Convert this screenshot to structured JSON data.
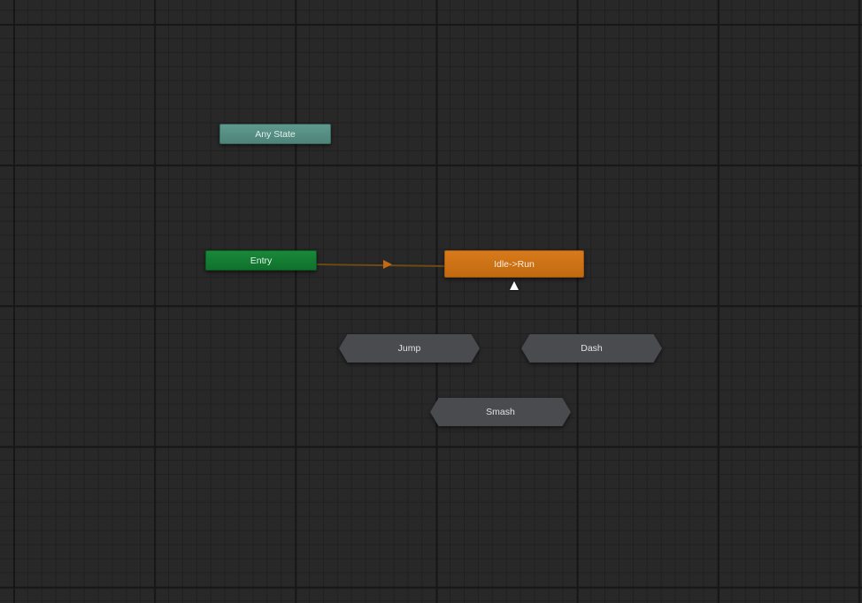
{
  "graph": {
    "nodes": {
      "any_state": {
        "label": "Any State",
        "color": "#5f9a8f"
      },
      "entry": {
        "label": "Entry",
        "color": "#18893a"
      },
      "default_state": {
        "label": "Idle->Run",
        "color": "#d77a1a"
      }
    },
    "sub_state_machines": [
      {
        "label": "Jump"
      },
      {
        "label": "Dash"
      },
      {
        "label": "Smash"
      }
    ],
    "transitions": [
      {
        "from": "Entry",
        "to": "Idle->Run"
      }
    ]
  },
  "colors": {
    "canvas_background": "#282828",
    "grid_minor": "#202020",
    "grid_major": "#171717",
    "sub_state_fill": "#4a4b4f",
    "transition_line": "#6b4a14",
    "transition_arrow": "#c26a12"
  },
  "icons": {
    "cursor": "mouse-pointer-icon"
  }
}
